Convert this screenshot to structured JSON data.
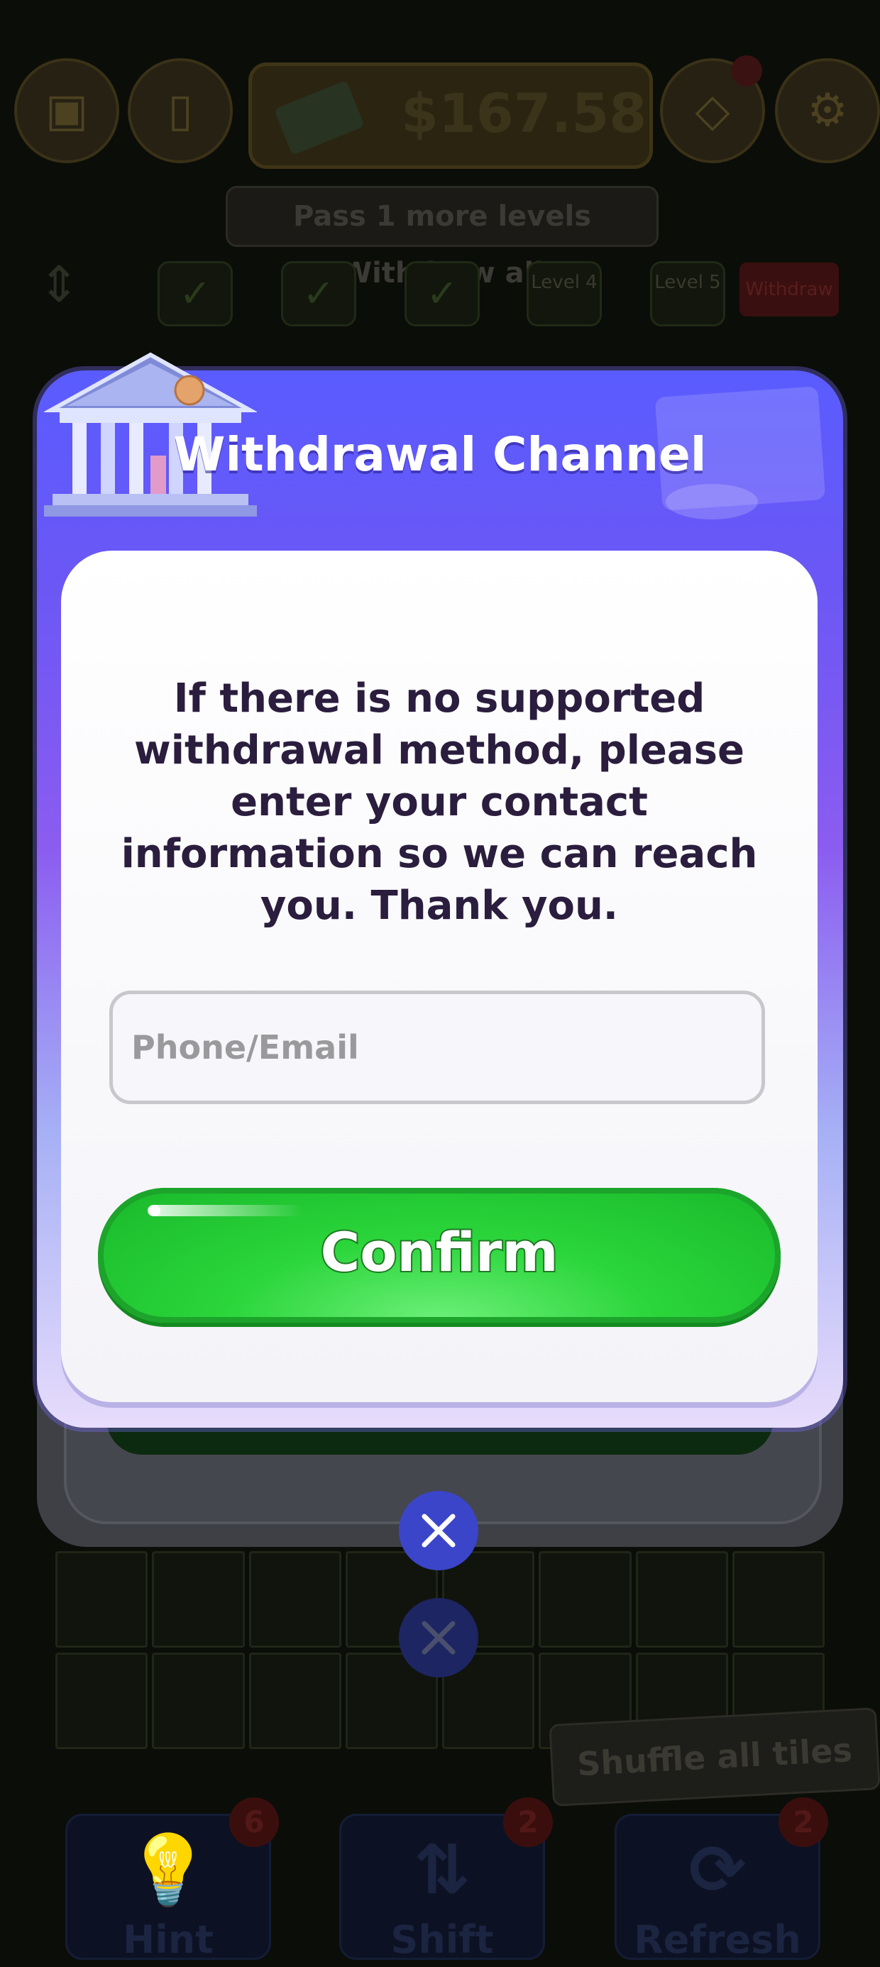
{
  "background": {
    "balance": "$167.58",
    "tip": "Pass 1 more levels Withdraw all",
    "levels": [
      {
        "label": "✓"
      },
      {
        "label": "✓"
      },
      {
        "label": "✓"
      },
      {
        "label": "Level 4"
      },
      {
        "label": "Level 5"
      }
    ],
    "withdraw_chip": "Withdraw",
    "shuffle_tip": "Shuffle all tiles",
    "powerups": [
      {
        "label": "Hint",
        "badge": "6"
      },
      {
        "label": "Shift",
        "badge": "2"
      },
      {
        "label": "Refresh",
        "badge": "2"
      }
    ]
  },
  "dialog": {
    "title": "Withdrawal Channel",
    "message": "If there is no supported withdrawal method, please enter your contact information so we can reach you. Thank you.",
    "input": {
      "placeholder": "Phone/Email",
      "value": ""
    },
    "confirm_label": "Confirm"
  },
  "colors": {
    "dialog_top": "#5a5cff",
    "confirm_green": "#2ad53a",
    "close_blue": "#3b45c9",
    "message_text": "#2a1d3d"
  }
}
